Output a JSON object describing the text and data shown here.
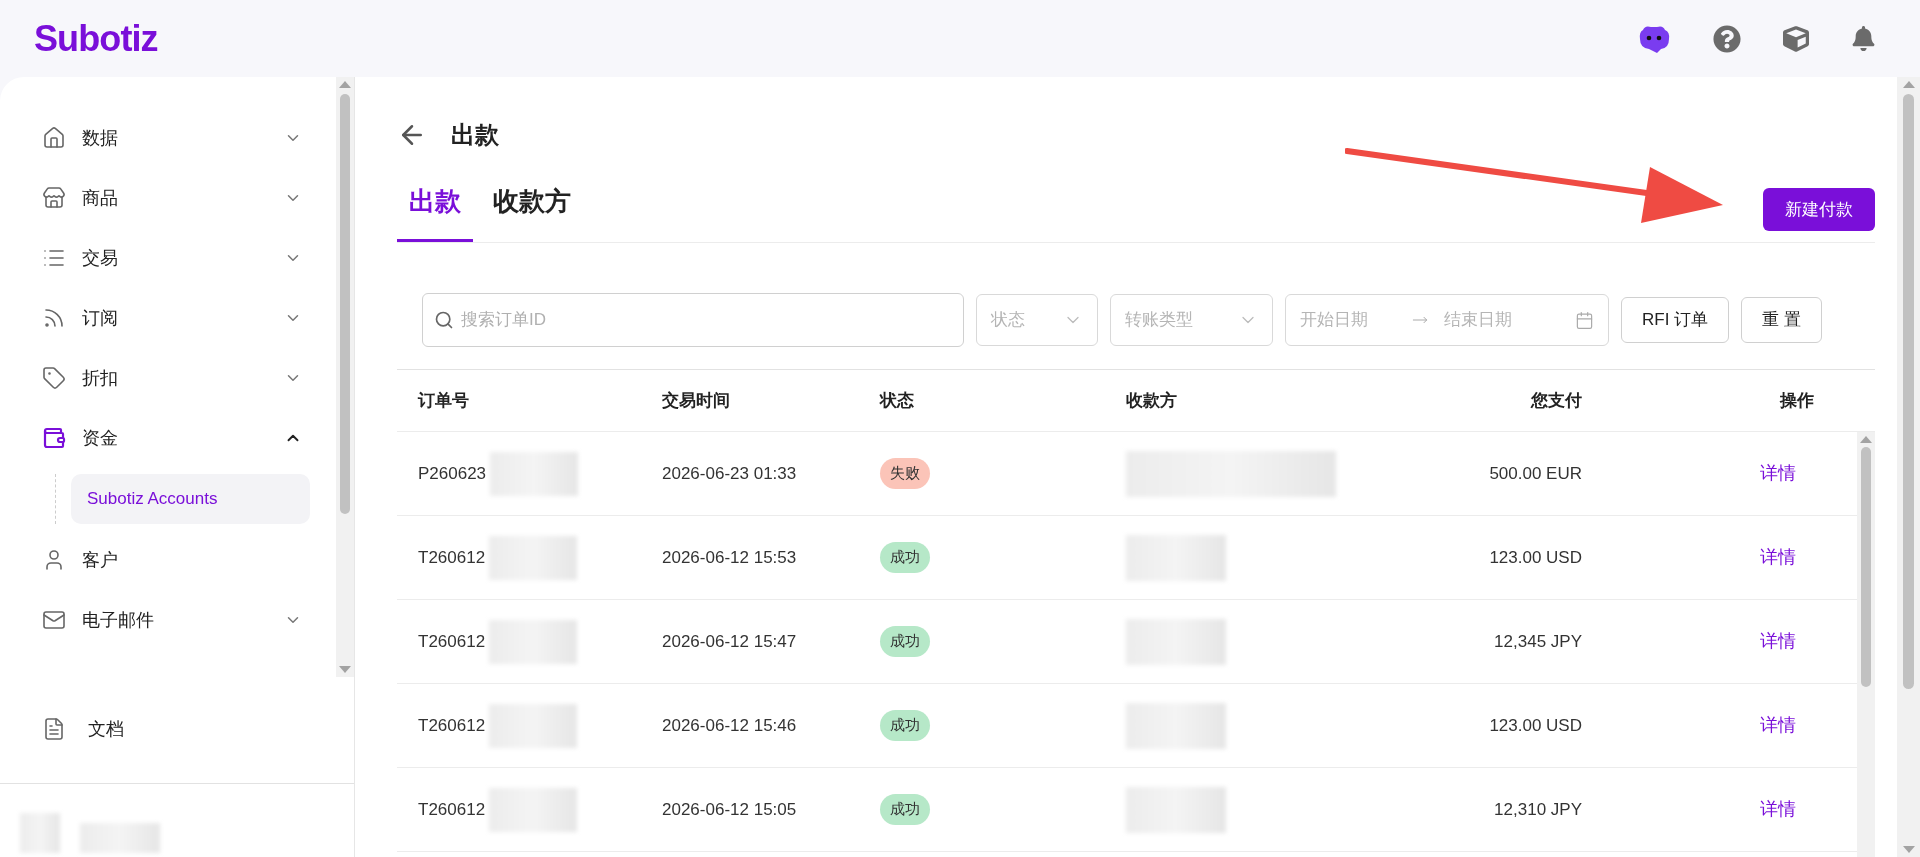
{
  "brand": "Subotiz",
  "sidebar": {
    "items": [
      {
        "label": "数据",
        "kind": "group",
        "expanded": false,
        "selected": false
      },
      {
        "label": "商品",
        "kind": "group",
        "expanded": false,
        "selected": false
      },
      {
        "label": "交易",
        "kind": "group",
        "expanded": false,
        "selected": false
      },
      {
        "label": "订阅",
        "kind": "group",
        "expanded": false,
        "selected": false
      },
      {
        "label": "折扣",
        "kind": "group",
        "expanded": false,
        "selected": false
      },
      {
        "label": "资金",
        "kind": "group",
        "expanded": true,
        "selected": true,
        "children": [
          {
            "label": "Subotiz Accounts",
            "selected": true
          }
        ]
      },
      {
        "label": "客户",
        "kind": "link",
        "selected": false
      },
      {
        "label": "电子邮件",
        "kind": "group",
        "expanded": false,
        "selected": false
      }
    ],
    "footer_link": {
      "label": "文档"
    }
  },
  "page": {
    "title": "出款",
    "tabs": [
      {
        "label": "出款",
        "selected": true
      },
      {
        "label": "收款方",
        "selected": false
      }
    ],
    "primary_button": "新建付款",
    "filters": {
      "search": {
        "placeholder": "搜索订单ID"
      },
      "status": {
        "placeholder": "状态"
      },
      "transfer_type": {
        "placeholder": "转账类型"
      },
      "date_range": {
        "start_placeholder": "开始日期",
        "end_placeholder": "结束日期"
      },
      "buttons": [
        "RFI 订单",
        "重 置"
      ]
    },
    "table": {
      "columns": [
        "订单号",
        "交易时间",
        "状态",
        "收款方",
        "您支付",
        "操作"
      ],
      "rows": [
        {
          "order_id": "P260623",
          "time": "2026-06-23 01:33",
          "status": {
            "label": "失败",
            "kind": "failed"
          },
          "amount": "500.00 EUR",
          "action": "详情"
        },
        {
          "order_id": "T260612",
          "time": "2026-06-12 15:53",
          "status": {
            "label": "成功",
            "kind": "success"
          },
          "amount": "123.00 USD",
          "action": "详情"
        },
        {
          "order_id": "T260612",
          "time": "2026-06-12 15:47",
          "status": {
            "label": "成功",
            "kind": "success"
          },
          "amount": "12,345 JPY",
          "action": "详情"
        },
        {
          "order_id": "T260612",
          "time": "2026-06-12 15:46",
          "status": {
            "label": "成功",
            "kind": "success"
          },
          "amount": "123.00 USD",
          "action": "详情"
        },
        {
          "order_id": "T260612",
          "time": "2026-06-12 15:05",
          "status": {
            "label": "成功",
            "kind": "success"
          },
          "amount": "12,310 JPY",
          "action": "详情"
        }
      ]
    }
  }
}
